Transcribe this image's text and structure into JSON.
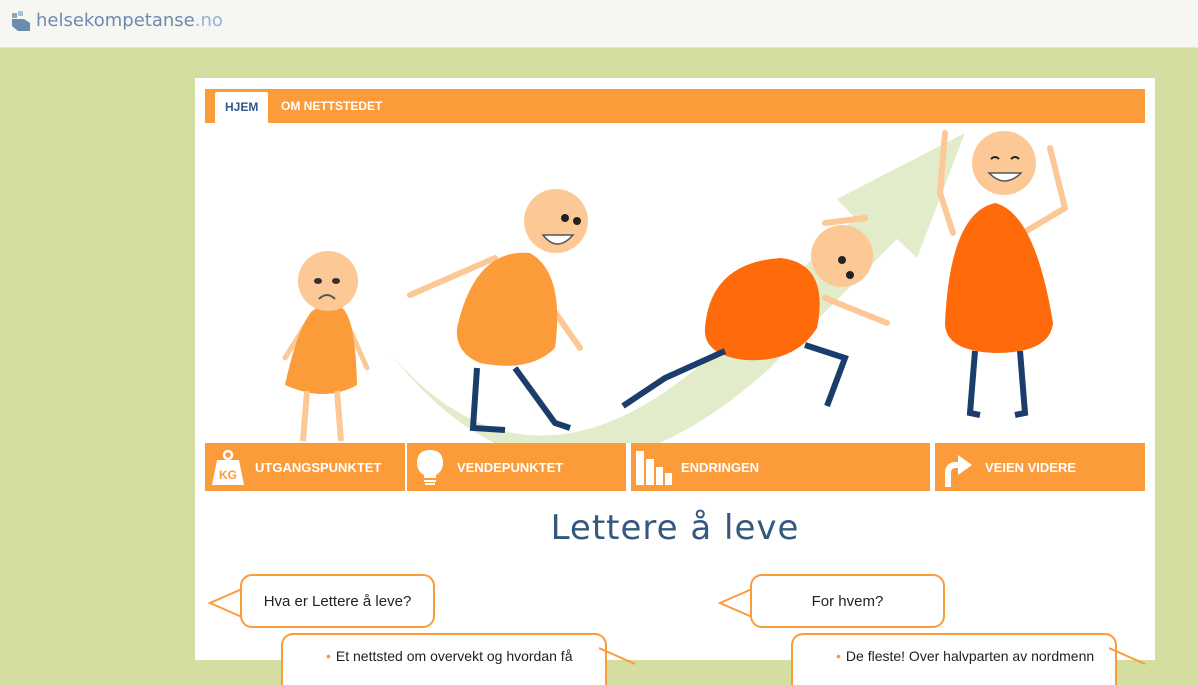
{
  "site": {
    "logo_text": "helsekompetanse",
    "logo_tld": ".no"
  },
  "nav": {
    "tabs": [
      {
        "label": "HJEM",
        "active": true
      },
      {
        "label": "OM NETTSTEDET",
        "active": false
      }
    ]
  },
  "menu": {
    "items": [
      {
        "label": "UTGANGSPUNKTET",
        "icon": "kg-weight-icon",
        "icon_text": "KG"
      },
      {
        "label": "VENDEPUNKTET",
        "icon": "lightbulb-icon"
      },
      {
        "label": "ENDRINGEN",
        "icon": "bar-chart-icon"
      },
      {
        "label": "VEIEN VIDERE",
        "icon": "arrow-up-right-icon"
      }
    ]
  },
  "main": {
    "title": "Lettere å leve",
    "left": {
      "question": "Hva er Lettere å leve?",
      "bullet": "Et nettsted om overvekt og hvordan få"
    },
    "right": {
      "question": "For hvem?",
      "bullet": "De fleste! Over halvparten av nordmenn"
    }
  },
  "colors": {
    "accent": "#fb9b3a",
    "background": "#d3dea0",
    "title": "#34587e"
  }
}
